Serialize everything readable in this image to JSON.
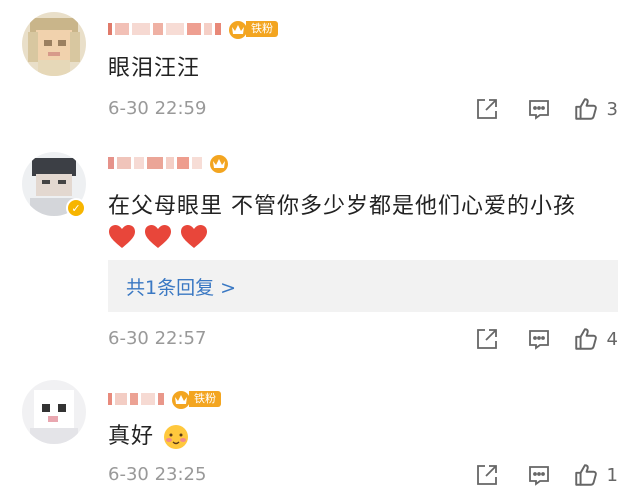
{
  "comments": [
    {
      "text": "眼泪汪汪",
      "fan_badge": "铁粉",
      "time": "6-30 22:59",
      "likes": "3"
    },
    {
      "text": "在父母眼里 不管你多少岁都是他们心爱的小孩",
      "time": "6-30 22:57",
      "likes": "4",
      "replies_label": "共1条回复 >"
    },
    {
      "text": "真好",
      "fan_badge": "铁粉",
      "time": "6-30 23:25",
      "likes": "1"
    }
  ],
  "icons": {
    "share": "share-icon",
    "comment": "comment-icon",
    "like": "thumbs-up-icon",
    "heart": "red-heart-emoji",
    "blush": "blush-emoji"
  },
  "colors": {
    "link": "#3a78c3",
    "badge": "#f3a520",
    "time": "#999999",
    "heart": "#e8463a"
  }
}
